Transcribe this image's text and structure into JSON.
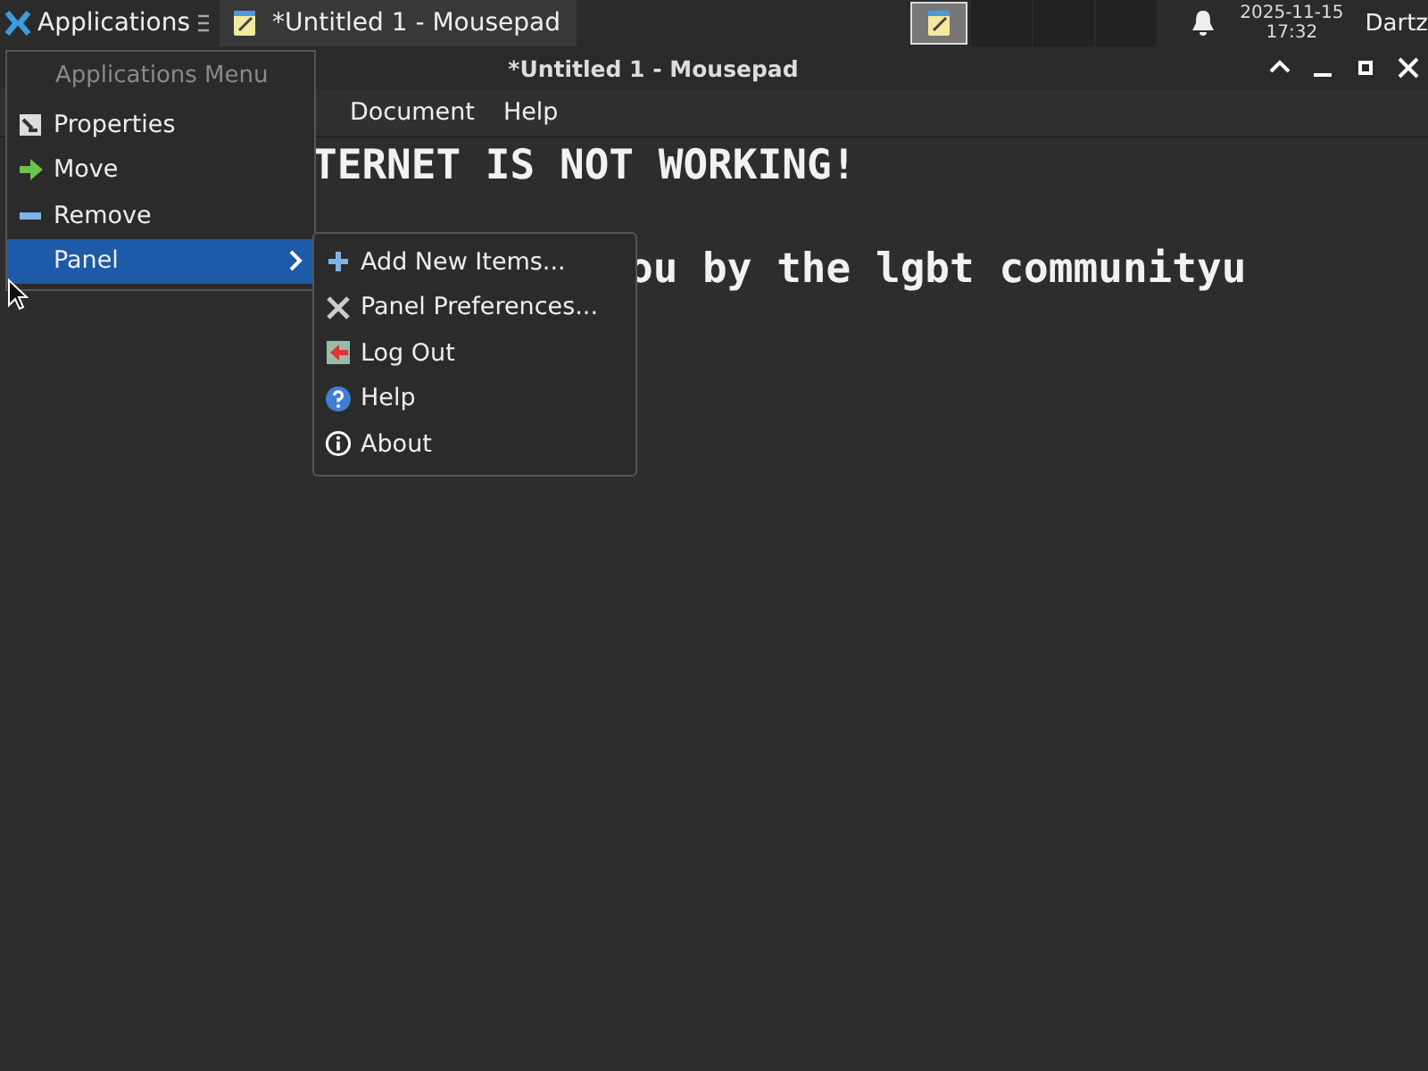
{
  "taskbar": {
    "applications_label": "Applications",
    "task": {
      "title": "*Untitled 1 - Mousepad",
      "selected": false
    },
    "workspaces": [
      {
        "selected": true
      },
      {
        "selected": false
      },
      {
        "selected": false
      },
      {
        "selected": false
      }
    ],
    "clock": {
      "date": "2025-11-15",
      "time": "17:32"
    },
    "user": "Dartz"
  },
  "window": {
    "title": "*Untitled 1 - Mousepad"
  },
  "menubar": [
    {
      "label": "Document"
    },
    {
      "label": "Help"
    }
  ],
  "editor": {
    "lines": [
      {
        "text": "TERNET IS NOT WORKING!",
        "kind": "line1"
      },
      {
        "text": "ou by the lgbt communityu",
        "kind": "line2"
      }
    ]
  },
  "applications_menu": {
    "header": "Applications Menu",
    "items": [
      {
        "label": "Properties",
        "selected": false,
        "submenu": false
      },
      {
        "label": "Move",
        "selected": false,
        "submenu": false
      },
      {
        "label": "Remove",
        "selected": false,
        "submenu": false
      },
      {
        "label": "Panel",
        "selected": true,
        "submenu": true
      }
    ]
  },
  "panel_submenu": {
    "items": [
      {
        "label": "Add New Items..."
      },
      {
        "label": "Panel Preferences..."
      },
      {
        "label": "Log Out"
      },
      {
        "label": "Help"
      },
      {
        "label": "About"
      }
    ]
  }
}
